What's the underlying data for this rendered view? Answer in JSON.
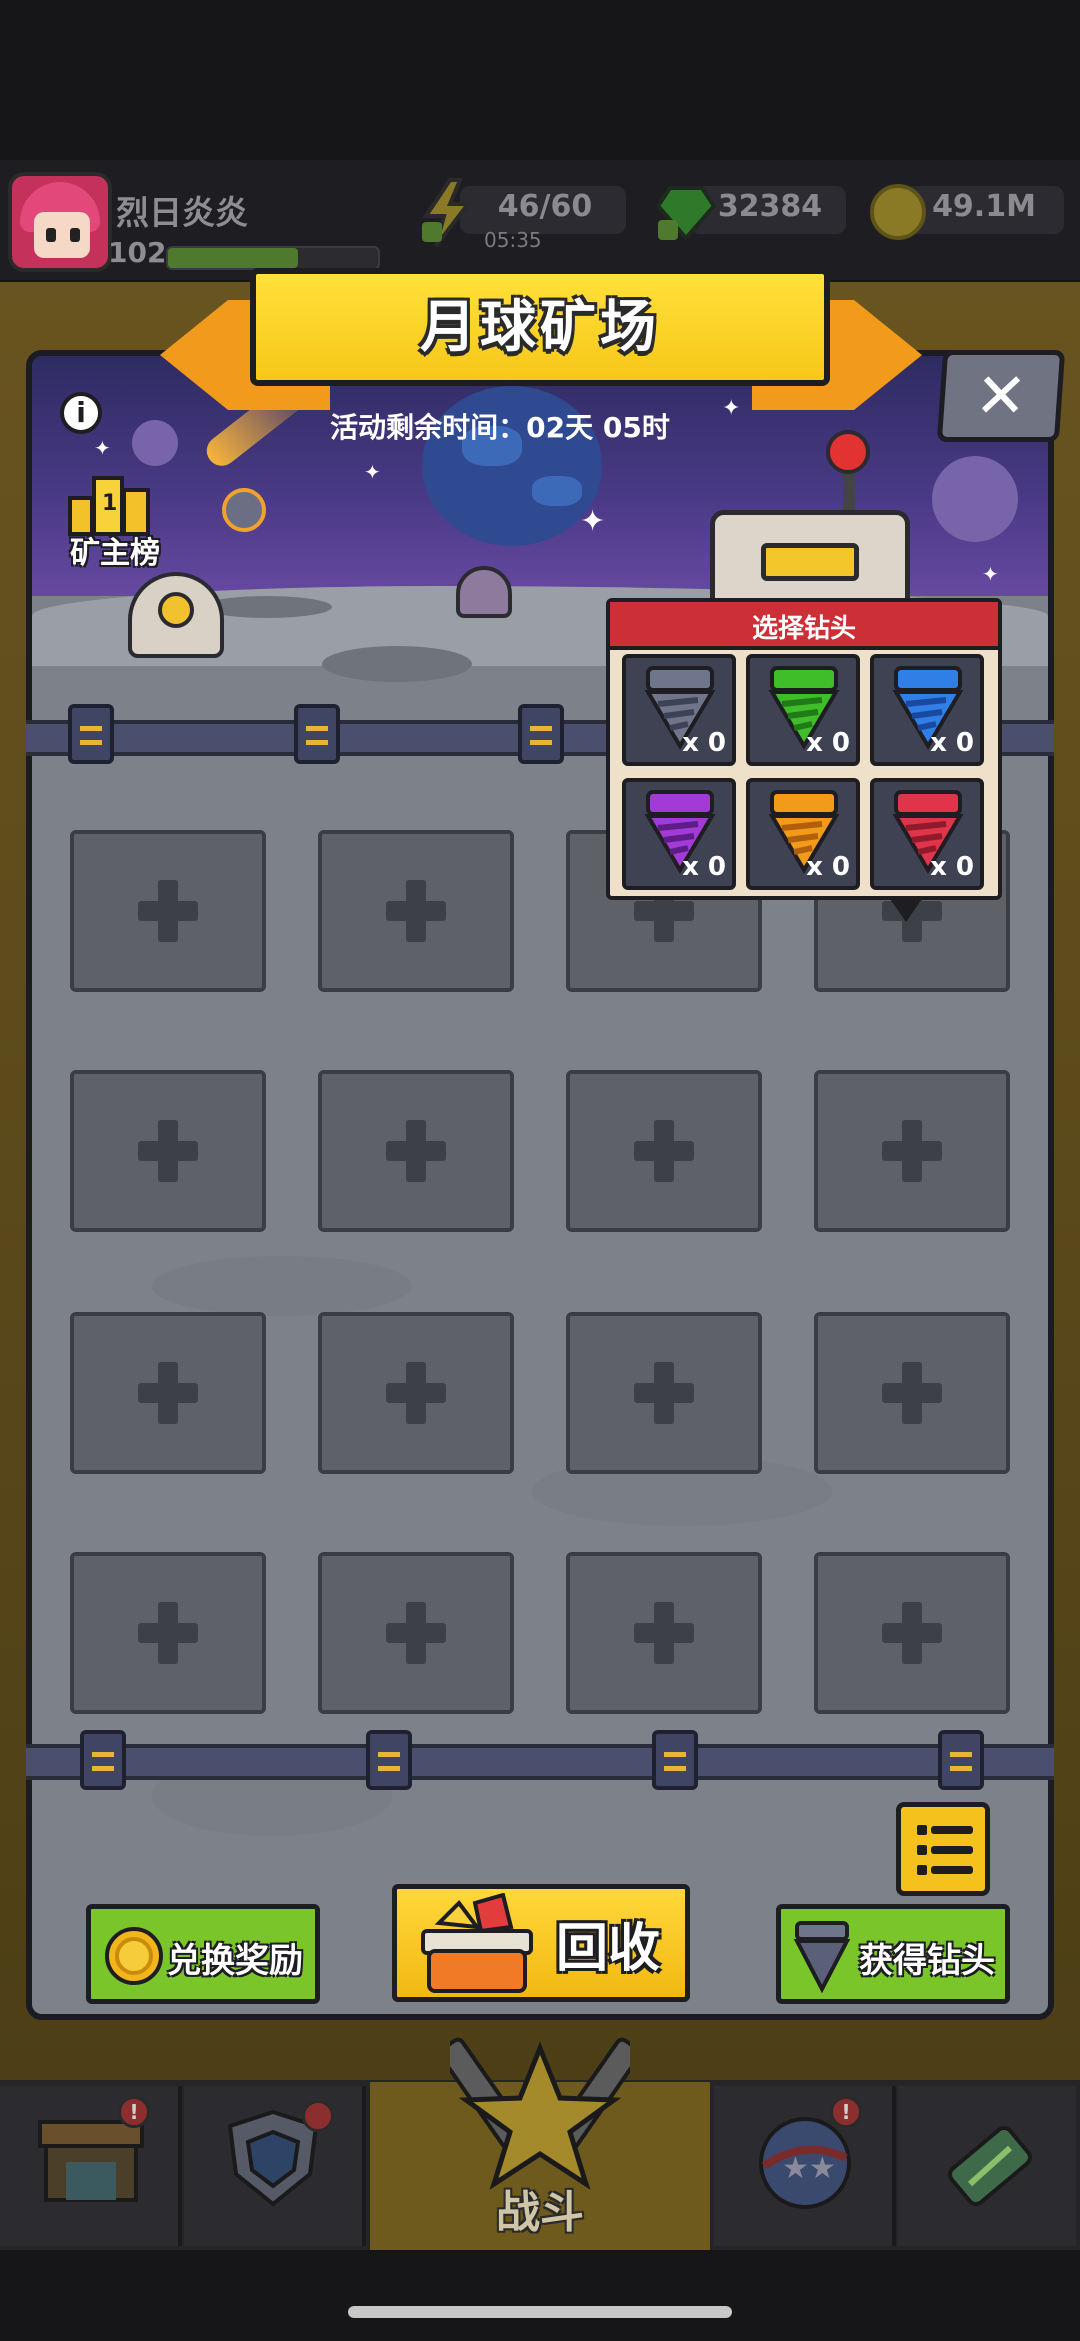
{
  "player": {
    "name": "烈日炎炎",
    "level": "102",
    "xp_fraction": 0.62
  },
  "resources": {
    "energy": {
      "value": "46/60",
      "timer": "05:35",
      "icon": "lightning-icon"
    },
    "gems": {
      "value": "32384",
      "icon": "green-gem-icon"
    },
    "coins": {
      "value": "49.1M",
      "icon": "coin-icon"
    }
  },
  "modal": {
    "title": "月球矿场",
    "close_glyph": "✕",
    "info_glyph": "i",
    "timer_text": "活动剩余时间：02天 05时",
    "leaderboard_label": "矿主榜",
    "leaderboard_rank": "1"
  },
  "drill_popup": {
    "title": "选择钻头",
    "drills": [
      {
        "name": "gray-drill",
        "count": "x 0",
        "color": "#6f768c",
        "dark": "#3d4257"
      },
      {
        "name": "green-drill",
        "count": "x 0",
        "color": "#3fbe2a",
        "dark": "#1f7a17"
      },
      {
        "name": "blue-drill",
        "count": "x 0",
        "color": "#2f7fe6",
        "dark": "#1a4aa0"
      },
      {
        "name": "purple-drill",
        "count": "x 0",
        "color": "#a23ad6",
        "dark": "#5e1c86"
      },
      {
        "name": "orange-drill",
        "count": "x 0",
        "color": "#f29a1a",
        "dark": "#b0600c"
      },
      {
        "name": "red-drill",
        "count": "x 0",
        "color": "#e0344a",
        "dark": "#8e1a2a"
      }
    ]
  },
  "slots": {
    "count": 16,
    "icon": "plus-icon"
  },
  "buttons": {
    "exchange_label": "兑换奖励",
    "recycle_label": "回收",
    "get_drill_label": "获得钻头"
  },
  "nav": {
    "battle_label": "战斗",
    "items": [
      "shop-icon",
      "shield-icon",
      "battle-icon",
      "globe-icon",
      "dna-icon"
    ],
    "badge_glyph": "!"
  },
  "colors": {
    "accent_yellow": "#f7c718",
    "accent_green": "#7ac62a",
    "accent_red": "#cc2f35"
  }
}
